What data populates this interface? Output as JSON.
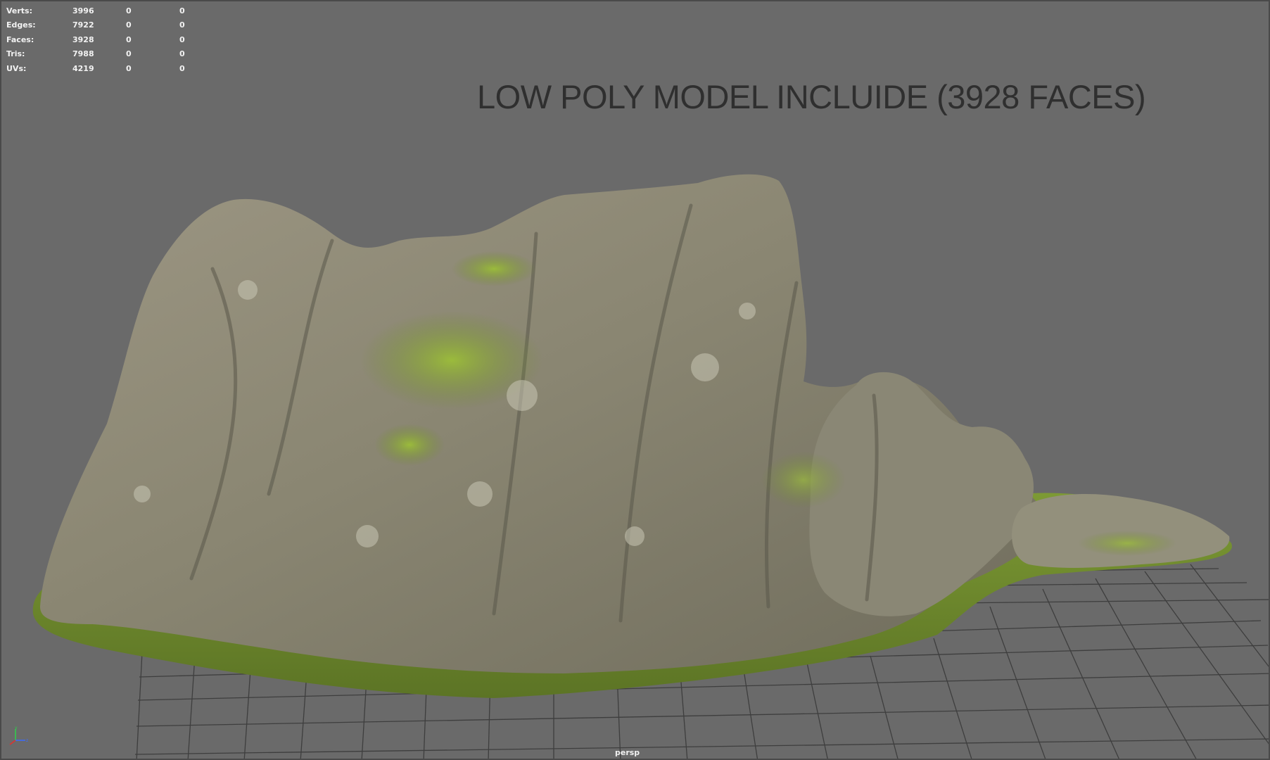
{
  "hud": {
    "rows": [
      {
        "label": "Verts:",
        "value": "3996",
        "sel1": "0",
        "sel2": "0"
      },
      {
        "label": "Edges:",
        "value": "7922",
        "sel1": "0",
        "sel2": "0"
      },
      {
        "label": "Faces:",
        "value": "3928",
        "sel1": "0",
        "sel2": "0"
      },
      {
        "label": "Tris:",
        "value": "7988",
        "sel1": "0",
        "sel2": "0"
      },
      {
        "label": "UVs:",
        "value": "4219",
        "sel1": "0",
        "sel2": "0"
      }
    ]
  },
  "overlay_title": "LOW POLY MODEL INCLUIDE (3928 FACES)",
  "camera_label": "persp",
  "colors": {
    "viewport_bg": "#6a6a6a",
    "grid_line": "#3c3c3c",
    "rock_base": "#8f8a78",
    "moss": "#7f9a32",
    "grass": "#6f8a2e"
  },
  "icons": {
    "axis_gizmo": "axis-gizmo-icon"
  }
}
